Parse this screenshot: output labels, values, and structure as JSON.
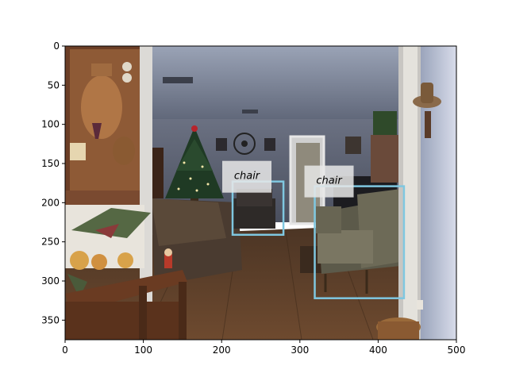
{
  "image": {
    "description_free": true,
    "x_range": [
      0,
      500
    ],
    "y_range": [
      375,
      0
    ],
    "x_ticks": [
      0,
      100,
      200,
      300,
      400,
      500
    ],
    "y_ticks": [
      0,
      50,
      100,
      150,
      200,
      250,
      300,
      350
    ]
  },
  "detections": [
    {
      "label": "chair",
      "bbox_data": [
        214,
        173,
        279,
        241
      ],
      "color": "#7fc7e0"
    },
    {
      "label": "chair",
      "bbox_data": [
        319,
        179,
        433,
        322
      ],
      "color": "#7fc7e0"
    }
  ],
  "colors": {
    "box": "#7fc7e0",
    "label_bg": "#e8e8e8"
  }
}
